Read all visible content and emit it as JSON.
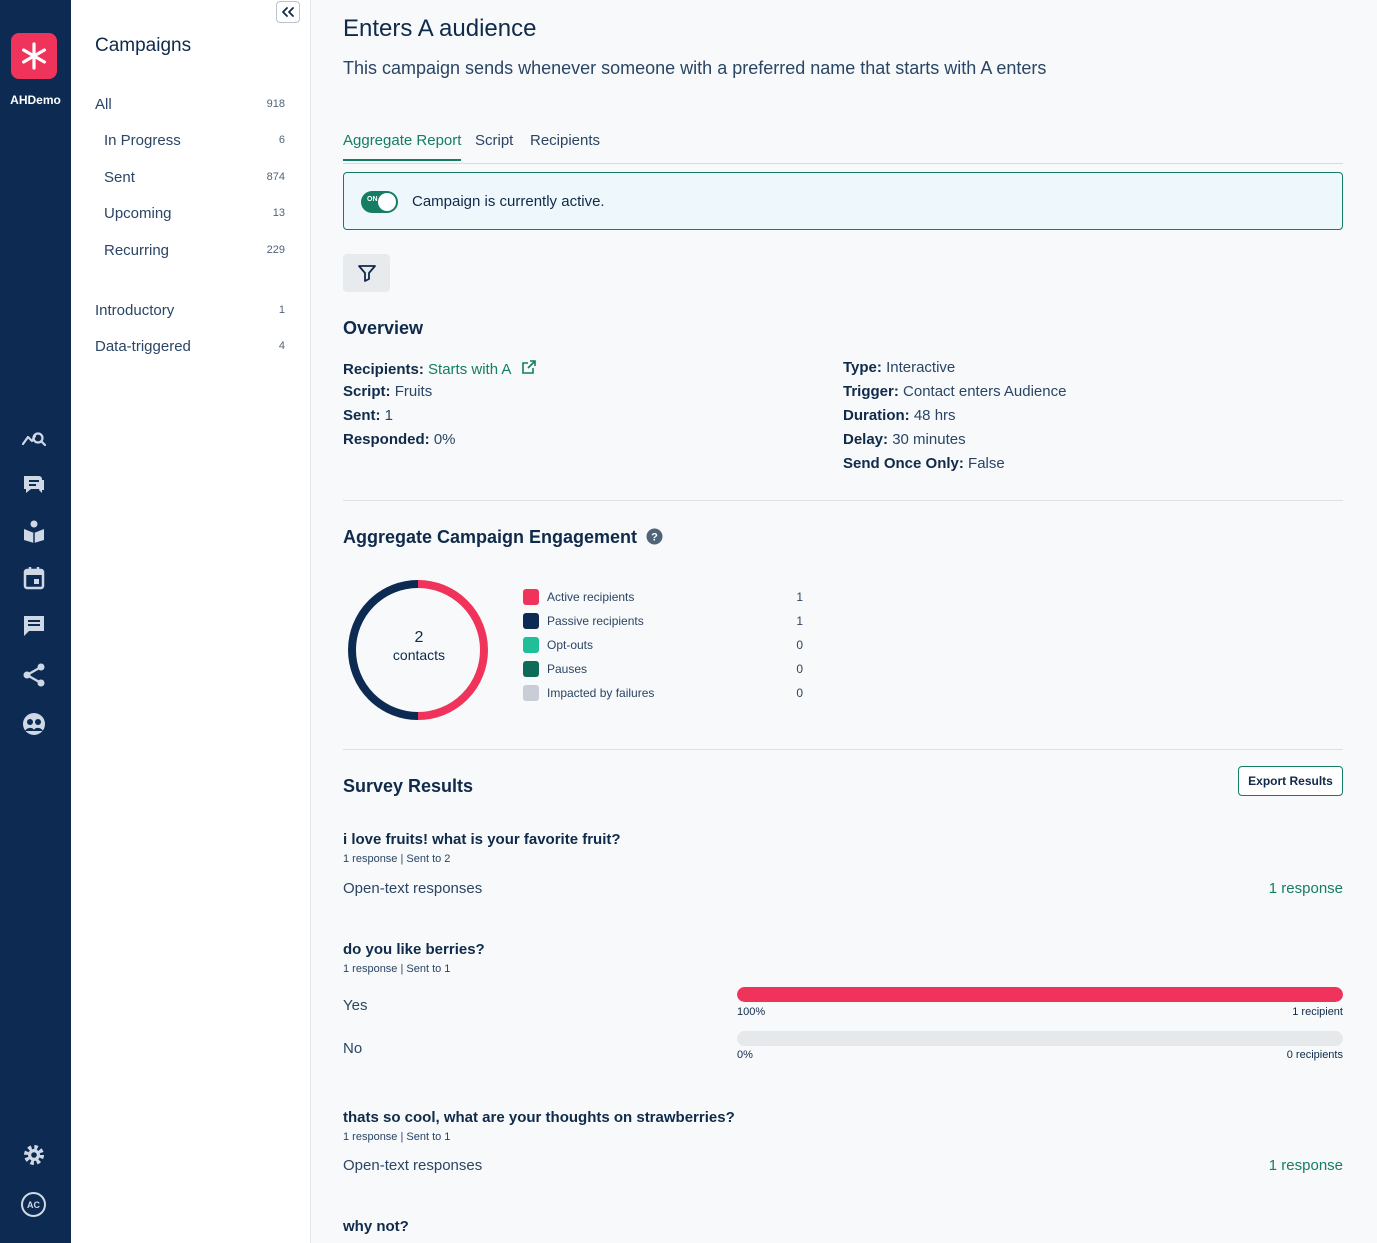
{
  "rail": {
    "org_name": "AHDemo",
    "avatar_initials": "AC",
    "icons": [
      "analytics-icon",
      "conversations-icon",
      "knowledge-base-icon",
      "calendar-icon",
      "messages-icon",
      "integrations-icon",
      "contacts-icon",
      "settings-icon"
    ]
  },
  "sidebar": {
    "title": "Campaigns",
    "items": [
      {
        "label": "All",
        "count": "918"
      },
      {
        "label": "In Progress",
        "count": "6"
      },
      {
        "label": "Sent",
        "count": "874"
      },
      {
        "label": "Upcoming",
        "count": "13"
      },
      {
        "label": "Recurring",
        "count": "229"
      },
      {
        "label": "Introductory",
        "count": "1"
      },
      {
        "label": "Data-triggered",
        "count": "4"
      }
    ]
  },
  "header": {
    "title": "Enters A audience",
    "description": "This campaign sends whenever someone with a preferred name that starts with A enters"
  },
  "tabs": [
    "Aggregate Report",
    "Script",
    "Recipients"
  ],
  "active_banner": {
    "toggle_label": "ON",
    "text": "Campaign is currently active."
  },
  "overview": {
    "title": "Overview",
    "left": [
      {
        "label": "Recipients:",
        "value": "Starts with A"
      },
      {
        "label": "Script:",
        "value": "Fruits"
      },
      {
        "label": "Sent:",
        "value": "1"
      },
      {
        "label": "Responded:",
        "value": "0%"
      }
    ],
    "right": [
      {
        "label": "Type:",
        "value": "Interactive"
      },
      {
        "label": "Trigger:",
        "value": "Contact enters Audience"
      },
      {
        "label": "Duration:",
        "value": "48 hrs"
      },
      {
        "label": "Delay:",
        "value": "30 minutes"
      },
      {
        "label": "Send Once Only:",
        "value": "False"
      }
    ]
  },
  "engagement": {
    "title": "Aggregate Campaign Engagement",
    "total": "2",
    "total_label": "contacts",
    "legend": [
      {
        "label": "Active recipients",
        "value": "1",
        "color": "#f0335a"
      },
      {
        "label": "Passive recipients",
        "value": "1",
        "color": "#0d2b52"
      },
      {
        "label": "Opt-outs",
        "value": "0",
        "color": "#1fbf9a"
      },
      {
        "label": "Pauses",
        "value": "0",
        "color": "#0d6b57"
      },
      {
        "label": "Impacted by failures",
        "value": "0",
        "color": "#c9ced6"
      }
    ]
  },
  "survey": {
    "title": "Survey Results",
    "export_label": "Export Results",
    "questions": [
      {
        "title": "i love fruits! what is your favorite fruit?",
        "meta": "1 response | Sent to 2",
        "kind": "Open-text responses",
        "responses": "1 response"
      },
      {
        "title": "do you like berries?",
        "meta": "1 response | Sent to 1",
        "options": [
          {
            "label": "Yes",
            "percent_text": "100%",
            "count_text": "1 recipient",
            "fraction": 1.0
          },
          {
            "label": "No",
            "percent_text": "0%",
            "count_text": "0 recipients",
            "fraction": 0.0
          }
        ]
      },
      {
        "title": "thats so cool, what are your thoughts on strawberries?",
        "meta": "1 response | Sent to 1",
        "kind": "Open-text responses",
        "responses": "1 response"
      },
      {
        "title": "why not?"
      }
    ]
  }
}
